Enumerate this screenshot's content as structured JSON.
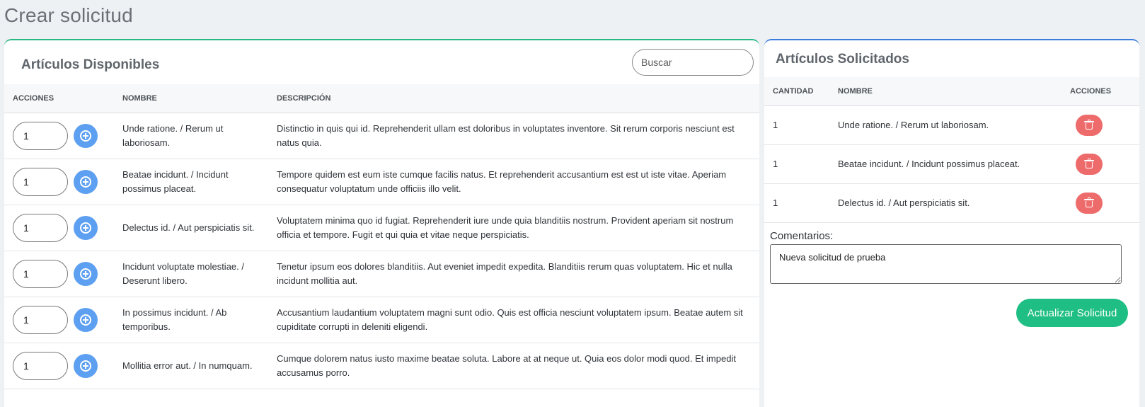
{
  "page": {
    "title": "Crear solicitud"
  },
  "available": {
    "title": "Artículos Disponibles",
    "search_placeholder": "Buscar",
    "columns": {
      "actions": "ACCIONES",
      "name": "NOMBRE",
      "description": "DESCRIPCIÓN"
    },
    "rows": [
      {
        "qty": "1",
        "name": "Unde ratione. / Rerum ut laboriosam.",
        "description": "Distinctio in quis qui id. Reprehenderit ullam est doloribus in voluptates inventore. Sit rerum corporis nesciunt est natus quia."
      },
      {
        "qty": "1",
        "name": "Beatae incidunt. / Incidunt possimus placeat.",
        "description": "Tempore quidem est eum iste cumque facilis natus. Et reprehenderit accusantium est est ut iste vitae. Aperiam consequatur voluptatum unde officiis illo velit."
      },
      {
        "qty": "1",
        "name": "Delectus id. / Aut perspiciatis sit.",
        "description": "Voluptatem minima quo id fugiat. Reprehenderit iure unde quia blanditiis nostrum. Provident aperiam sit nostrum officia et tempore. Fugit et qui quia et vitae neque perspiciatis."
      },
      {
        "qty": "1",
        "name": "Incidunt voluptate molestiae. / Deserunt libero.",
        "description": "Tenetur ipsum eos dolores blanditiis. Aut eveniet impedit expedita. Blanditiis rerum quas voluptatem. Hic et nulla incidunt mollitia aut."
      },
      {
        "qty": "1",
        "name": "In possimus incidunt. / Ab temporibus.",
        "description": "Accusantium laudantium voluptatem magni sunt odio. Quis est officia nesciunt voluptatem ipsum. Beatae autem sit cupiditate corrupti in deleniti eligendi."
      },
      {
        "qty": "1",
        "name": "Mollitia error aut. / In numquam.",
        "description": "Cumque dolorem natus iusto maxime beatae soluta. Labore at at neque ut. Quia eos dolor modi quod. Et impedit accusamus porro."
      }
    ]
  },
  "requested": {
    "title": "Artículos Solicitados",
    "columns": {
      "qty": "CANTIDAD",
      "name": "NOMBRE",
      "actions": "ACCIONES"
    },
    "rows": [
      {
        "qty": "1",
        "name": "Unde ratione. / Rerum ut laboriosam."
      },
      {
        "qty": "1",
        "name": "Beatae incidunt. / Incidunt possimus placeat."
      },
      {
        "qty": "1",
        "name": "Delectus id. / Aut perspiciatis sit."
      }
    ],
    "comments_label": "Comentarios:",
    "comments_value": "Nueva solicitud de prueba",
    "submit_label": "Actualizar Solicitud"
  },
  "colors": {
    "accent_green": "#1fbe84",
    "accent_blue": "#5d9ff0",
    "danger": "#ee6b6b"
  },
  "icons": {
    "add": "plus-circle-icon",
    "delete": "trash-icon"
  }
}
